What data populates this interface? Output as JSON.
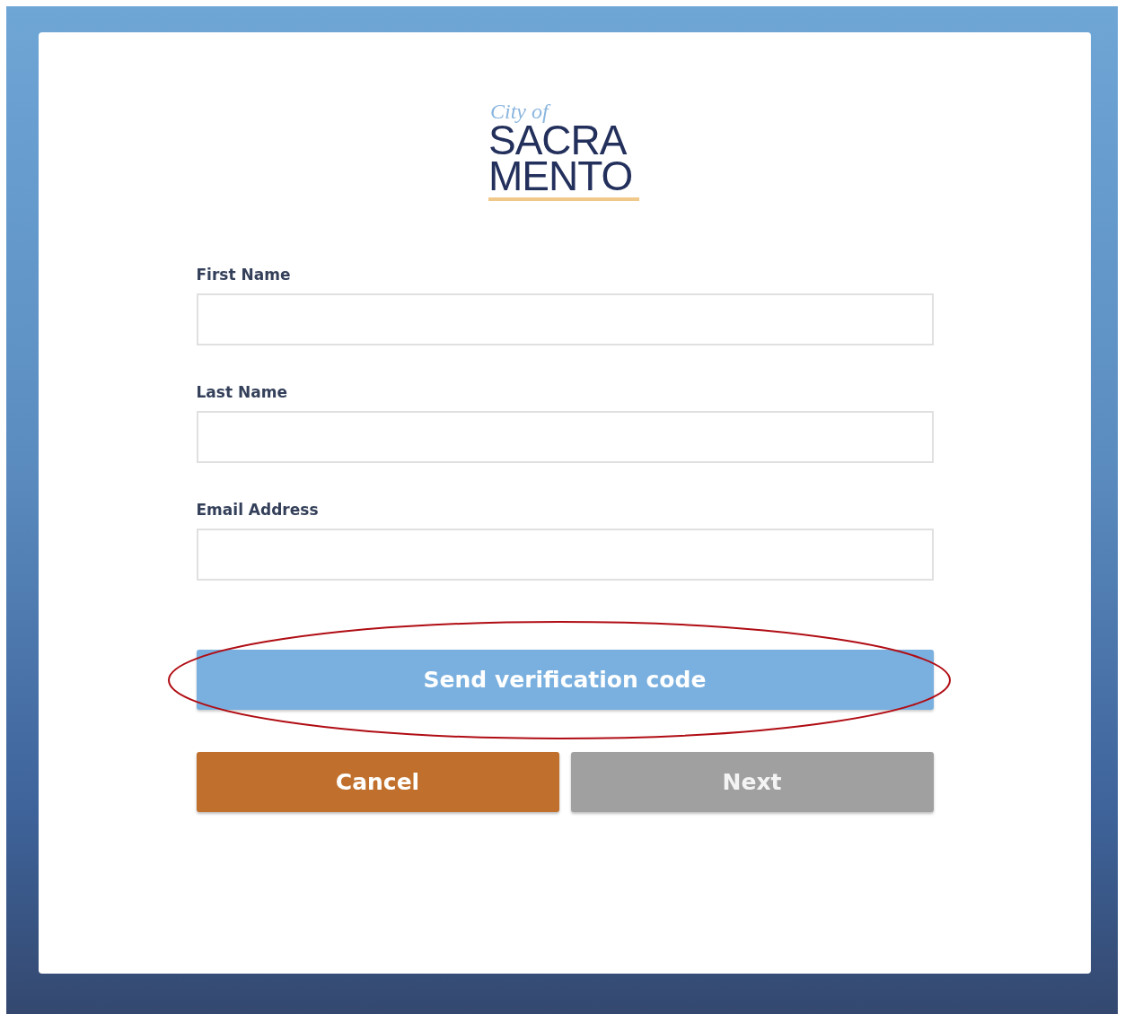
{
  "logo": {
    "prefix": "City of",
    "line_1": "SACRA",
    "line_2": "MENTO"
  },
  "fields": [
    {
      "label": "First Name"
    },
    {
      "label": "Last Name"
    },
    {
      "label": "Email Address"
    }
  ],
  "primary_button": {
    "label": "Send verification code",
    "highlighted": true
  },
  "buttons": [
    {
      "label": "Cancel",
      "kind": "cancel",
      "disabled": false
    },
    {
      "label": "Next",
      "kind": "next",
      "disabled": true
    }
  ]
}
